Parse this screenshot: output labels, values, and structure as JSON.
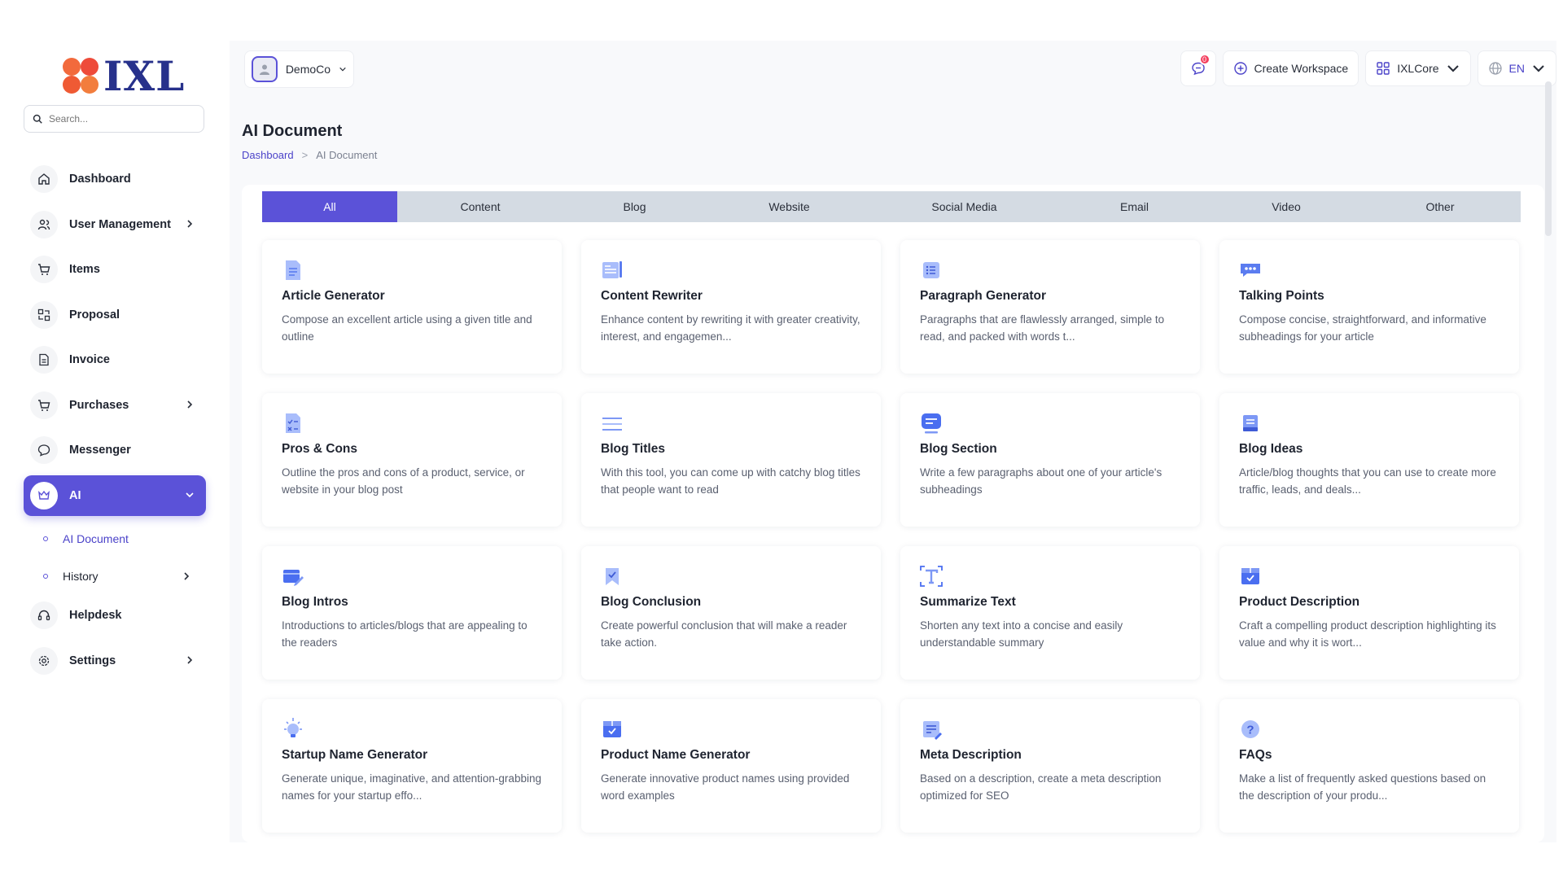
{
  "brand": {
    "logo_text": "IXL"
  },
  "search": {
    "placeholder": "Search..."
  },
  "sidebar": {
    "items": [
      {
        "label": "Dashboard",
        "icon": "home-icon"
      },
      {
        "label": "User Management",
        "icon": "users-icon",
        "chevron": true
      },
      {
        "label": "Items",
        "icon": "cart-icon"
      },
      {
        "label": "Proposal",
        "icon": "proposal-icon"
      },
      {
        "label": "Invoice",
        "icon": "invoice-icon"
      },
      {
        "label": "Purchases",
        "icon": "purchases-icon",
        "chevron": true
      },
      {
        "label": "Messenger",
        "icon": "chat-icon"
      },
      {
        "label": "AI",
        "icon": "ai-icon",
        "active": true,
        "expanded": true
      }
    ],
    "subitems": [
      {
        "label": "AI Document",
        "active": true
      },
      {
        "label": "History",
        "chevron": true
      }
    ],
    "after_items": [
      {
        "label": "Helpdesk",
        "icon": "headset-icon"
      },
      {
        "label": "Settings",
        "icon": "gear-icon",
        "chevron": true
      }
    ]
  },
  "topbar": {
    "company": "DemoCo",
    "notification_count": "0",
    "create_workspace": "Create Workspace",
    "workspace": "IXLCore",
    "language": "EN"
  },
  "page": {
    "title": "AI Document",
    "breadcrumb": {
      "home": "Dashboard",
      "separator": ">",
      "current": "AI Document"
    }
  },
  "tabs": [
    "All",
    "Content",
    "Blog",
    "Website",
    "Social Media",
    "Email",
    "Video",
    "Other"
  ],
  "cards": [
    {
      "title": "Article Generator",
      "desc": "Compose an excellent article using a given title and outline",
      "icon": "article-doc-icon"
    },
    {
      "title": "Content Rewriter",
      "desc": "Enhance content by rewriting it with greater creativity, interest, and engagemen...",
      "icon": "rewrite-icon"
    },
    {
      "title": "Paragraph Generator",
      "desc": "Paragraphs that are flawlessly arranged, simple to read, and packed with words t...",
      "icon": "paragraph-list-icon"
    },
    {
      "title": "Talking Points",
      "desc": "Compose concise, straightforward, and informative subheadings for your article",
      "icon": "speech-bubble-icon"
    },
    {
      "title": "Pros & Cons",
      "desc": "Outline the pros and cons of a product, service, or website in your blog post",
      "icon": "checklist-doc-icon"
    },
    {
      "title": "Blog Titles",
      "desc": "With this tool, you can come up with catchy blog titles that people want to read",
      "icon": "lines-icon"
    },
    {
      "title": "Blog Section",
      "desc": "Write a few paragraphs about one of your article's subheadings",
      "icon": "message-box-icon"
    },
    {
      "title": "Blog Ideas",
      "desc": "Article/blog thoughts that you can use to create more traffic, leads, and deals...",
      "icon": "notebook-icon"
    },
    {
      "title": "Blog Intros",
      "desc": "Introductions to articles/blogs that are appealing to the readers",
      "icon": "edit-card-icon"
    },
    {
      "title": "Blog Conclusion",
      "desc": "Create powerful conclusion that will make a reader take action.",
      "icon": "bookmark-check-icon"
    },
    {
      "title": "Summarize Text",
      "desc": "Shorten any text into a concise and easily understandable summary",
      "icon": "text-frame-icon"
    },
    {
      "title": "Product Description",
      "desc": "Craft a compelling product description highlighting its value and why it is wort...",
      "icon": "box-check-icon"
    },
    {
      "title": "Startup Name Generator",
      "desc": "Generate unique, imaginative, and attention-grabbing names for your startup effo...",
      "icon": "lightbulb-icon"
    },
    {
      "title": "Product Name Generator",
      "desc": "Generate innovative product names using provided word examples",
      "icon": "package-check-icon"
    },
    {
      "title": "Meta Description",
      "desc": "Based on a description, create a meta description optimized for SEO",
      "icon": "meta-doc-icon"
    },
    {
      "title": "FAQs",
      "desc": "Make a list of frequently asked questions based on the description of your produ...",
      "icon": "question-icon"
    }
  ],
  "colors": {
    "accent": "#5b52d8",
    "brand_text": "#27318b",
    "tab_bar": "#d4dbe3",
    "icon_blue": "#6b8cf5",
    "badge": "#f43f5e"
  }
}
